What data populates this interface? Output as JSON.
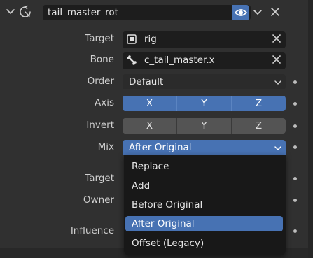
{
  "constraint": {
    "name": "tail_master_rot"
  },
  "fields": {
    "target_label": "Target",
    "target_value": "rig",
    "bone_label": "Bone",
    "bone_value": "c_tail_master.x",
    "order_label": "Order",
    "order_value": "Default",
    "axis_label": "Axis",
    "invert_label": "Invert",
    "mix_label": "Mix",
    "mix_value": "After Original",
    "target2_label": "Target",
    "owner_label": "Owner",
    "influence_label": "Influence"
  },
  "axis": {
    "x": "X",
    "y": "Y",
    "z": "Z",
    "enabled": [
      true,
      true,
      true
    ]
  },
  "invert": {
    "x": "X",
    "y": "Y",
    "z": "Z",
    "enabled": [
      false,
      false,
      false
    ]
  },
  "mix_menu": {
    "items": [
      "Replace",
      "Add",
      "Before Original",
      "After Original",
      "Offset (Legacy)"
    ],
    "selected": "After Original"
  },
  "colors": {
    "accent": "#4772b3",
    "panel": "#303030",
    "field": "#1d1d1d"
  },
  "icons": {
    "collapse": "chevron-down-icon",
    "constraint": "copy-rotation-icon",
    "visibility": "eye-icon",
    "target_object": "object-icon",
    "bone": "bone-icon",
    "clear": "close-icon",
    "keyframe": "dot-icon"
  }
}
